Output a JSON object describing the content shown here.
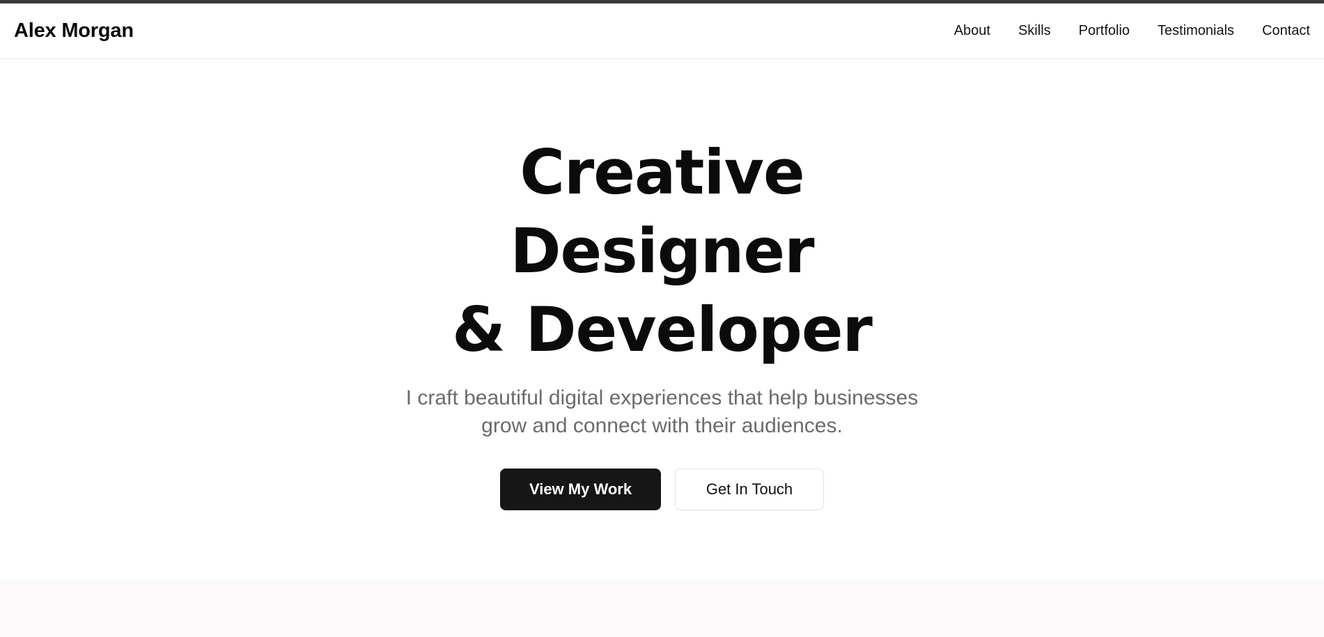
{
  "header": {
    "logo": "Alex Morgan",
    "nav": [
      {
        "label": "About"
      },
      {
        "label": "Skills"
      },
      {
        "label": "Portfolio"
      },
      {
        "label": "Testimonials"
      },
      {
        "label": "Contact"
      }
    ]
  },
  "hero": {
    "title_lines": [
      "Creative",
      "Designer",
      "& Developer"
    ],
    "subtitle_lines": [
      "I craft beautiful digital experiences that help businesses",
      "grow and connect with their audiences."
    ],
    "primary_button": "View My Work",
    "secondary_button": "Get In Touch"
  },
  "colors": {
    "top_bar": "#3a3a3a",
    "primary_button_bg": "#161616",
    "text_dark": "#0b0b0b",
    "text_muted": "#6b6b6b",
    "next_section_bg": "#fcfafb"
  }
}
